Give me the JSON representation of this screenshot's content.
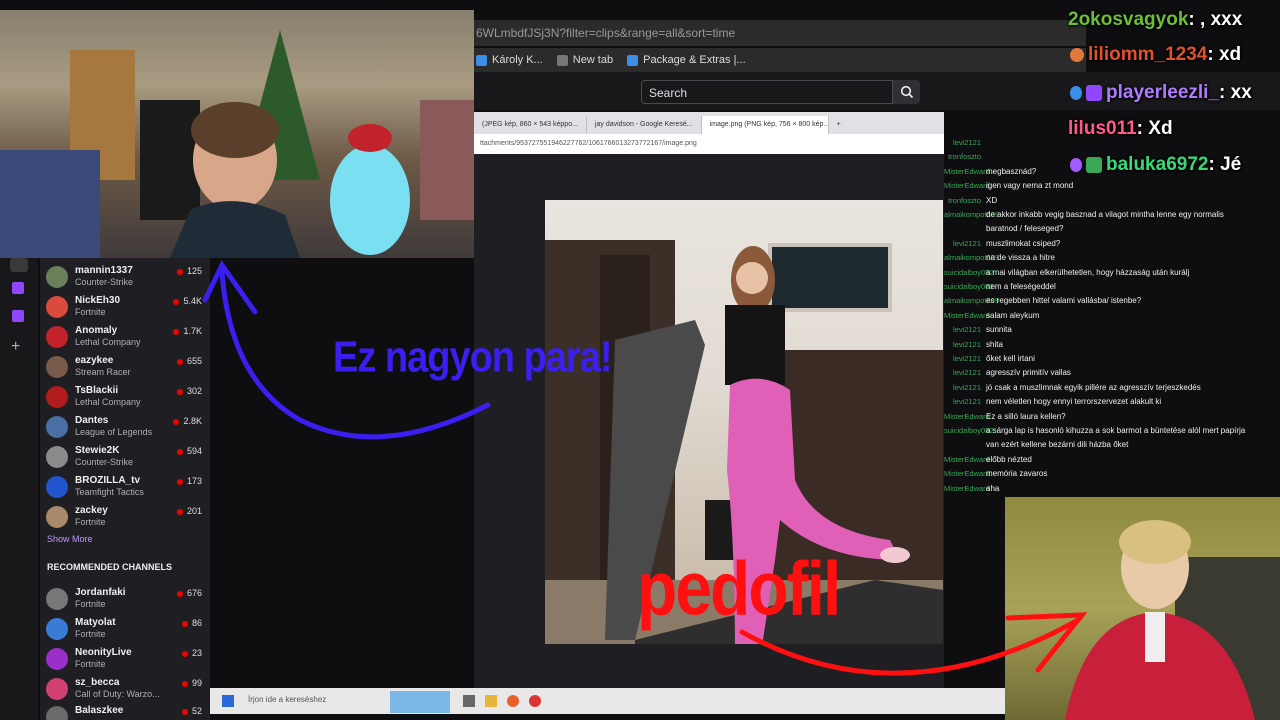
{
  "browser": {
    "url_fragment": "6WLmbdfJSj3N?filter=clips&range=all&sort=time",
    "bookmarks": [
      "Károly K...",
      "New tab",
      "Package & Extras |..."
    ]
  },
  "twitch": {
    "search_placeholder": "Search"
  },
  "inner_browser": {
    "tabs": [
      "(JPEG kép, 860 × 543 képpo...",
      "jay davidson - Google Keresé...",
      "image.png (PNG kép, 756 × 800 kép..."
    ],
    "url": "ttachments/953727551946227762/1061766013273772167/image.png"
  },
  "sidebar": {
    "followed": [
      {
        "name": "mannin1337",
        "game": "Counter-Strike",
        "viewers": "125",
        "color": "#6a7f5a"
      },
      {
        "name": "NickEh30",
        "game": "Fortnite",
        "viewers": "5.4K",
        "color": "#d94b3d"
      },
      {
        "name": "Anomaly",
        "game": "Lethal Company",
        "viewers": "1.7K",
        "color": "#c2222a"
      },
      {
        "name": "eazykee",
        "game": "Stream Racer",
        "viewers": "655",
        "color": "#7a5a4a"
      },
      {
        "name": "TsBlackii",
        "game": "Lethal Company",
        "viewers": "302",
        "color": "#b01c1c"
      },
      {
        "name": "Dantes",
        "game": "League of Legends",
        "viewers": "2.8K",
        "color": "#4a6fa5"
      },
      {
        "name": "Stewie2K",
        "game": "Counter-Strike",
        "viewers": "594",
        "color": "#8a8a8a"
      },
      {
        "name": "BROZILLA_tv",
        "game": "Teamfight Tactics",
        "viewers": "173",
        "color": "#2255cc"
      },
      {
        "name": "zackey",
        "game": "Fortnite",
        "viewers": "201",
        "color": "#a88a6a"
      }
    ],
    "show_more": "Show More",
    "recommended_header": "RECOMMENDED CHANNELS",
    "recommended": [
      {
        "name": "Jordanfaki",
        "game": "Fortnite",
        "viewers": "676",
        "color": "#777"
      },
      {
        "name": "Matyolat",
        "game": "Fortnite",
        "viewers": "86",
        "color": "#3a7bd5"
      },
      {
        "name": "NeonityLive",
        "game": "Fortnite",
        "viewers": "23",
        "color": "#9b30c8"
      },
      {
        "name": "sz_becca",
        "game": "Call of Duty: Warzo...",
        "viewers": "99",
        "color": "#d04070"
      },
      {
        "name": "Balaszkee",
        "game": "",
        "viewers": "52",
        "color": "#6a6a6a"
      }
    ]
  },
  "chat": {
    "messages": [
      {
        "user": "levi2121",
        "text": ""
      },
      {
        "user": "tronfoszto",
        "text": ""
      },
      {
        "user": "MisterEdward",
        "text": "megbasznád?"
      },
      {
        "user": "MisterEdward",
        "text": "igen vagy nema zt mond"
      },
      {
        "user": "tronfoszto",
        "text": "XD"
      },
      {
        "user": "almaikompot609",
        "text": "de akkor inkabb vegig basznad a vilagot mintha lenne egy normalis"
      },
      {
        "user": "",
        "text": "baratnod / feleseged?"
      },
      {
        "user": "levi2121",
        "text": "muszlimokat csiped?"
      },
      {
        "user": "almaikompot609",
        "text": "na de vissza a hitre"
      },
      {
        "user": "suicidalboy002",
        "text": "a mai világban elkerülhetetlen, hogy házzaság után kurálj"
      },
      {
        "user": "suicidalboy002",
        "text": "nem a feleségeddel"
      },
      {
        "user": "almaikompot609",
        "text": "es regebben hittel valami vallásba/ istenbe?"
      },
      {
        "user": "MisterEdward",
        "text": "salam aleykum"
      },
      {
        "user": "levi2121",
        "text": "sunnita"
      },
      {
        "user": "levi2121",
        "text": "shita"
      },
      {
        "user": "levi2121",
        "text": "őket kell irtani"
      },
      {
        "user": "levi2121",
        "text": "agresszív primitív vallas"
      },
      {
        "user": "levi2121",
        "text": "jó csak a muszlimnak egyik pillére az agresszív terjeszkedés"
      },
      {
        "user": "levi2121",
        "text": "nem véletlen hogy ennyi terrorszervezet alakult ki"
      },
      {
        "user": "MisterEdward",
        "text": "Ez a silló laura kellen?"
      },
      {
        "user": "suicidalboy002",
        "text": "a sárga lap is hasonló kihuzza a sok barmot a büntetése alól mert papírja"
      },
      {
        "user": "",
        "text": "van ezért kellene bezárni dili házba őket"
      },
      {
        "user": "MisterEdward",
        "text": "előbb nézted"
      },
      {
        "user": "MisterEdward",
        "text": "memória zavaros"
      },
      {
        "user": "MisterEdward",
        "text": "aha"
      }
    ]
  },
  "overlay_chat": [
    {
      "user": "2okosvagyok",
      "text": ": , xxx",
      "color": "#6bbf3a"
    },
    {
      "user": "liliomm_1234",
      "text": ": xd",
      "color": "#e0502a"
    },
    {
      "user": "playerleezli_",
      "text": ": xx",
      "color": "#b07cff"
    },
    {
      "user": "lilus011",
      "text": ": Xd",
      "color": "#ff5a8a"
    },
    {
      "user": "baluka6972",
      "text": ": Jé",
      "color": "#a35cff"
    }
  ],
  "taskbar": {
    "search_placeholder": "Írjon ide a kereséshez"
  },
  "annotations": {
    "blue_text": "Ez nagyon para!",
    "red_text": "pedofil"
  },
  "colors": {
    "twitch_purple": "#9147ff",
    "annotation_blue": "#3a1ff0",
    "annotation_red": "#ff1010"
  }
}
